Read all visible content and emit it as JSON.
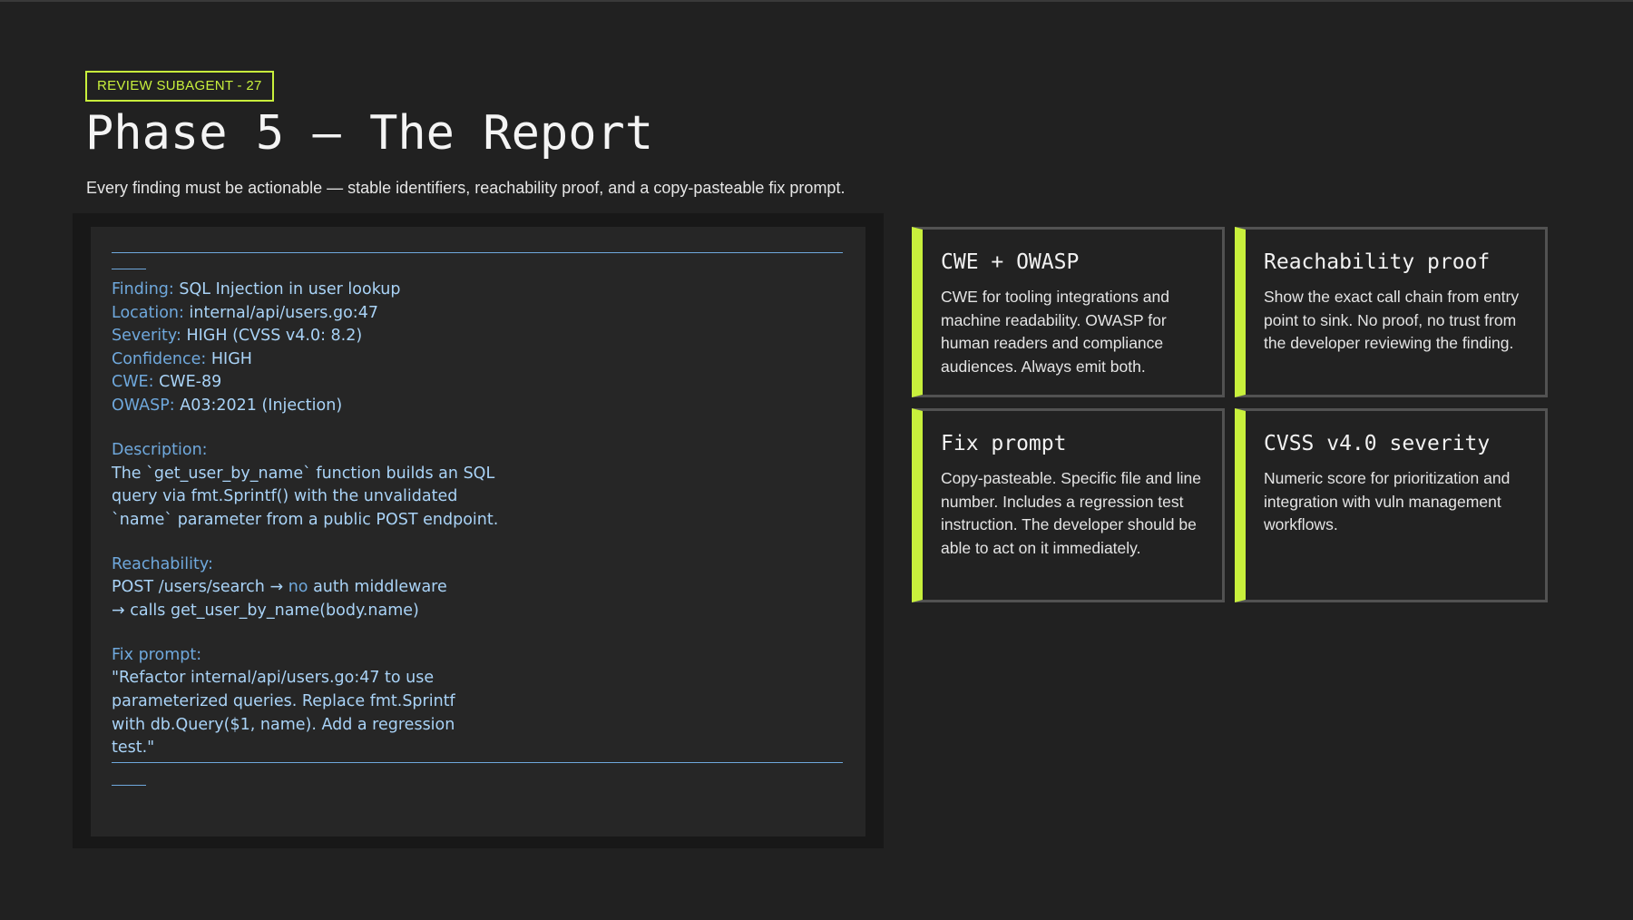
{
  "badge": "REVIEW SUBAGENT - 27",
  "title": "Phase 5 — The Report",
  "subtitle": "Every finding must be actionable — stable identifiers, reachability proof, and a copy-pasteable fix prompt.",
  "report": {
    "finding": {
      "label": "Finding:",
      "value": "SQL Injection in user lookup"
    },
    "location": {
      "label": "Location:",
      "value": "internal/api/users.go:47"
    },
    "severity": {
      "label": "Severity:",
      "value": "HIGH (CVSS v4.0: 8.2)"
    },
    "confidence": {
      "label": "Confidence:",
      "value": "HIGH"
    },
    "cwe": {
      "label": "CWE:",
      "value": "CWE-89"
    },
    "owasp": {
      "label": "OWASP:",
      "value": "A03:2021 (Injection)"
    },
    "description_label": "Description:",
    "description_lines": [
      "The `get_user_by_name` function builds an SQL",
      "query via fmt.Sprintf() with the unvalidated",
      "`name` parameter from a public POST endpoint."
    ],
    "reachability_label": "Reachability:",
    "reachability_line1_a": "POST /users/search → ",
    "reachability_line1_b": "no",
    "reachability_line1_c": " auth middleware",
    "reachability_line2": "→ calls get_user_by_name(body.name)",
    "fix_label": "Fix prompt:",
    "fix_lines": [
      "\"Refactor internal/api/users.go:47 to use",
      "parameterized queries. Replace fmt.Sprintf",
      "with db.Query($1, name). Add a regression",
      "test.\""
    ]
  },
  "cards": [
    {
      "title": "CWE + OWASP",
      "body": "CWE for tooling integrations and machine readability. OWASP for human readers and compliance audiences. Always emit both."
    },
    {
      "title": "Reachability proof",
      "body": "Show the exact call chain from entry point to sink. No proof, no trust from the developer reviewing the finding."
    },
    {
      "title": "Fix prompt",
      "body": "Copy-pasteable. Specific file and line number. Includes a regression test instruction. The developer should be able to act on it immediately."
    },
    {
      "title": "CVSS v4.0 severity",
      "body": "Numeric score for prioritization and integration with vuln management workflows."
    }
  ],
  "colors": {
    "accent": "#c8f03c",
    "code_text": "#8ec3f0",
    "background": "#212121"
  }
}
